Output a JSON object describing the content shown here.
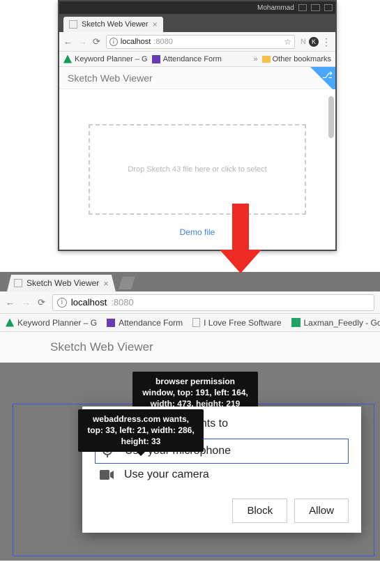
{
  "top_window": {
    "user_label": "Mohammad",
    "tab_title": "Sketch Web Viewer",
    "url_host": "localhost",
    "url_port": ":8080",
    "bookmarks": {
      "keyword_planner": "Keyword Planner – G",
      "attendance_form": "Attendance Form",
      "more": "»",
      "other_bookmarks": "Other bookmarks"
    },
    "viewer_heading": "Sketch Web Viewer",
    "dropzone_text": "Drop Sketch 43 file here or click to select",
    "demo_link": "Demo file"
  },
  "bottom_window": {
    "tab_title": "Sketch Web Viewer",
    "url_host": "localhost",
    "url_port": ":8080",
    "bookmarks": {
      "keyword_planner": "Keyword Planner – G",
      "attendance_form": "Attendance Form",
      "ilfs": "I Love Free Software",
      "laxman": "Laxman_Feedly - Goo"
    },
    "viewer_heading": "Sketch Web Viewer"
  },
  "tooltips": {
    "outer": "browser permission window, top: 191, left: 164, width: 473, height: 219",
    "inner": "webaddress.com wants, top: 33, left: 21, width: 286, height: 33"
  },
  "permission": {
    "origin_wants": "nts to",
    "mic": "Use your microphone",
    "cam": "Use your camera",
    "block": "Block",
    "allow": "Allow"
  }
}
